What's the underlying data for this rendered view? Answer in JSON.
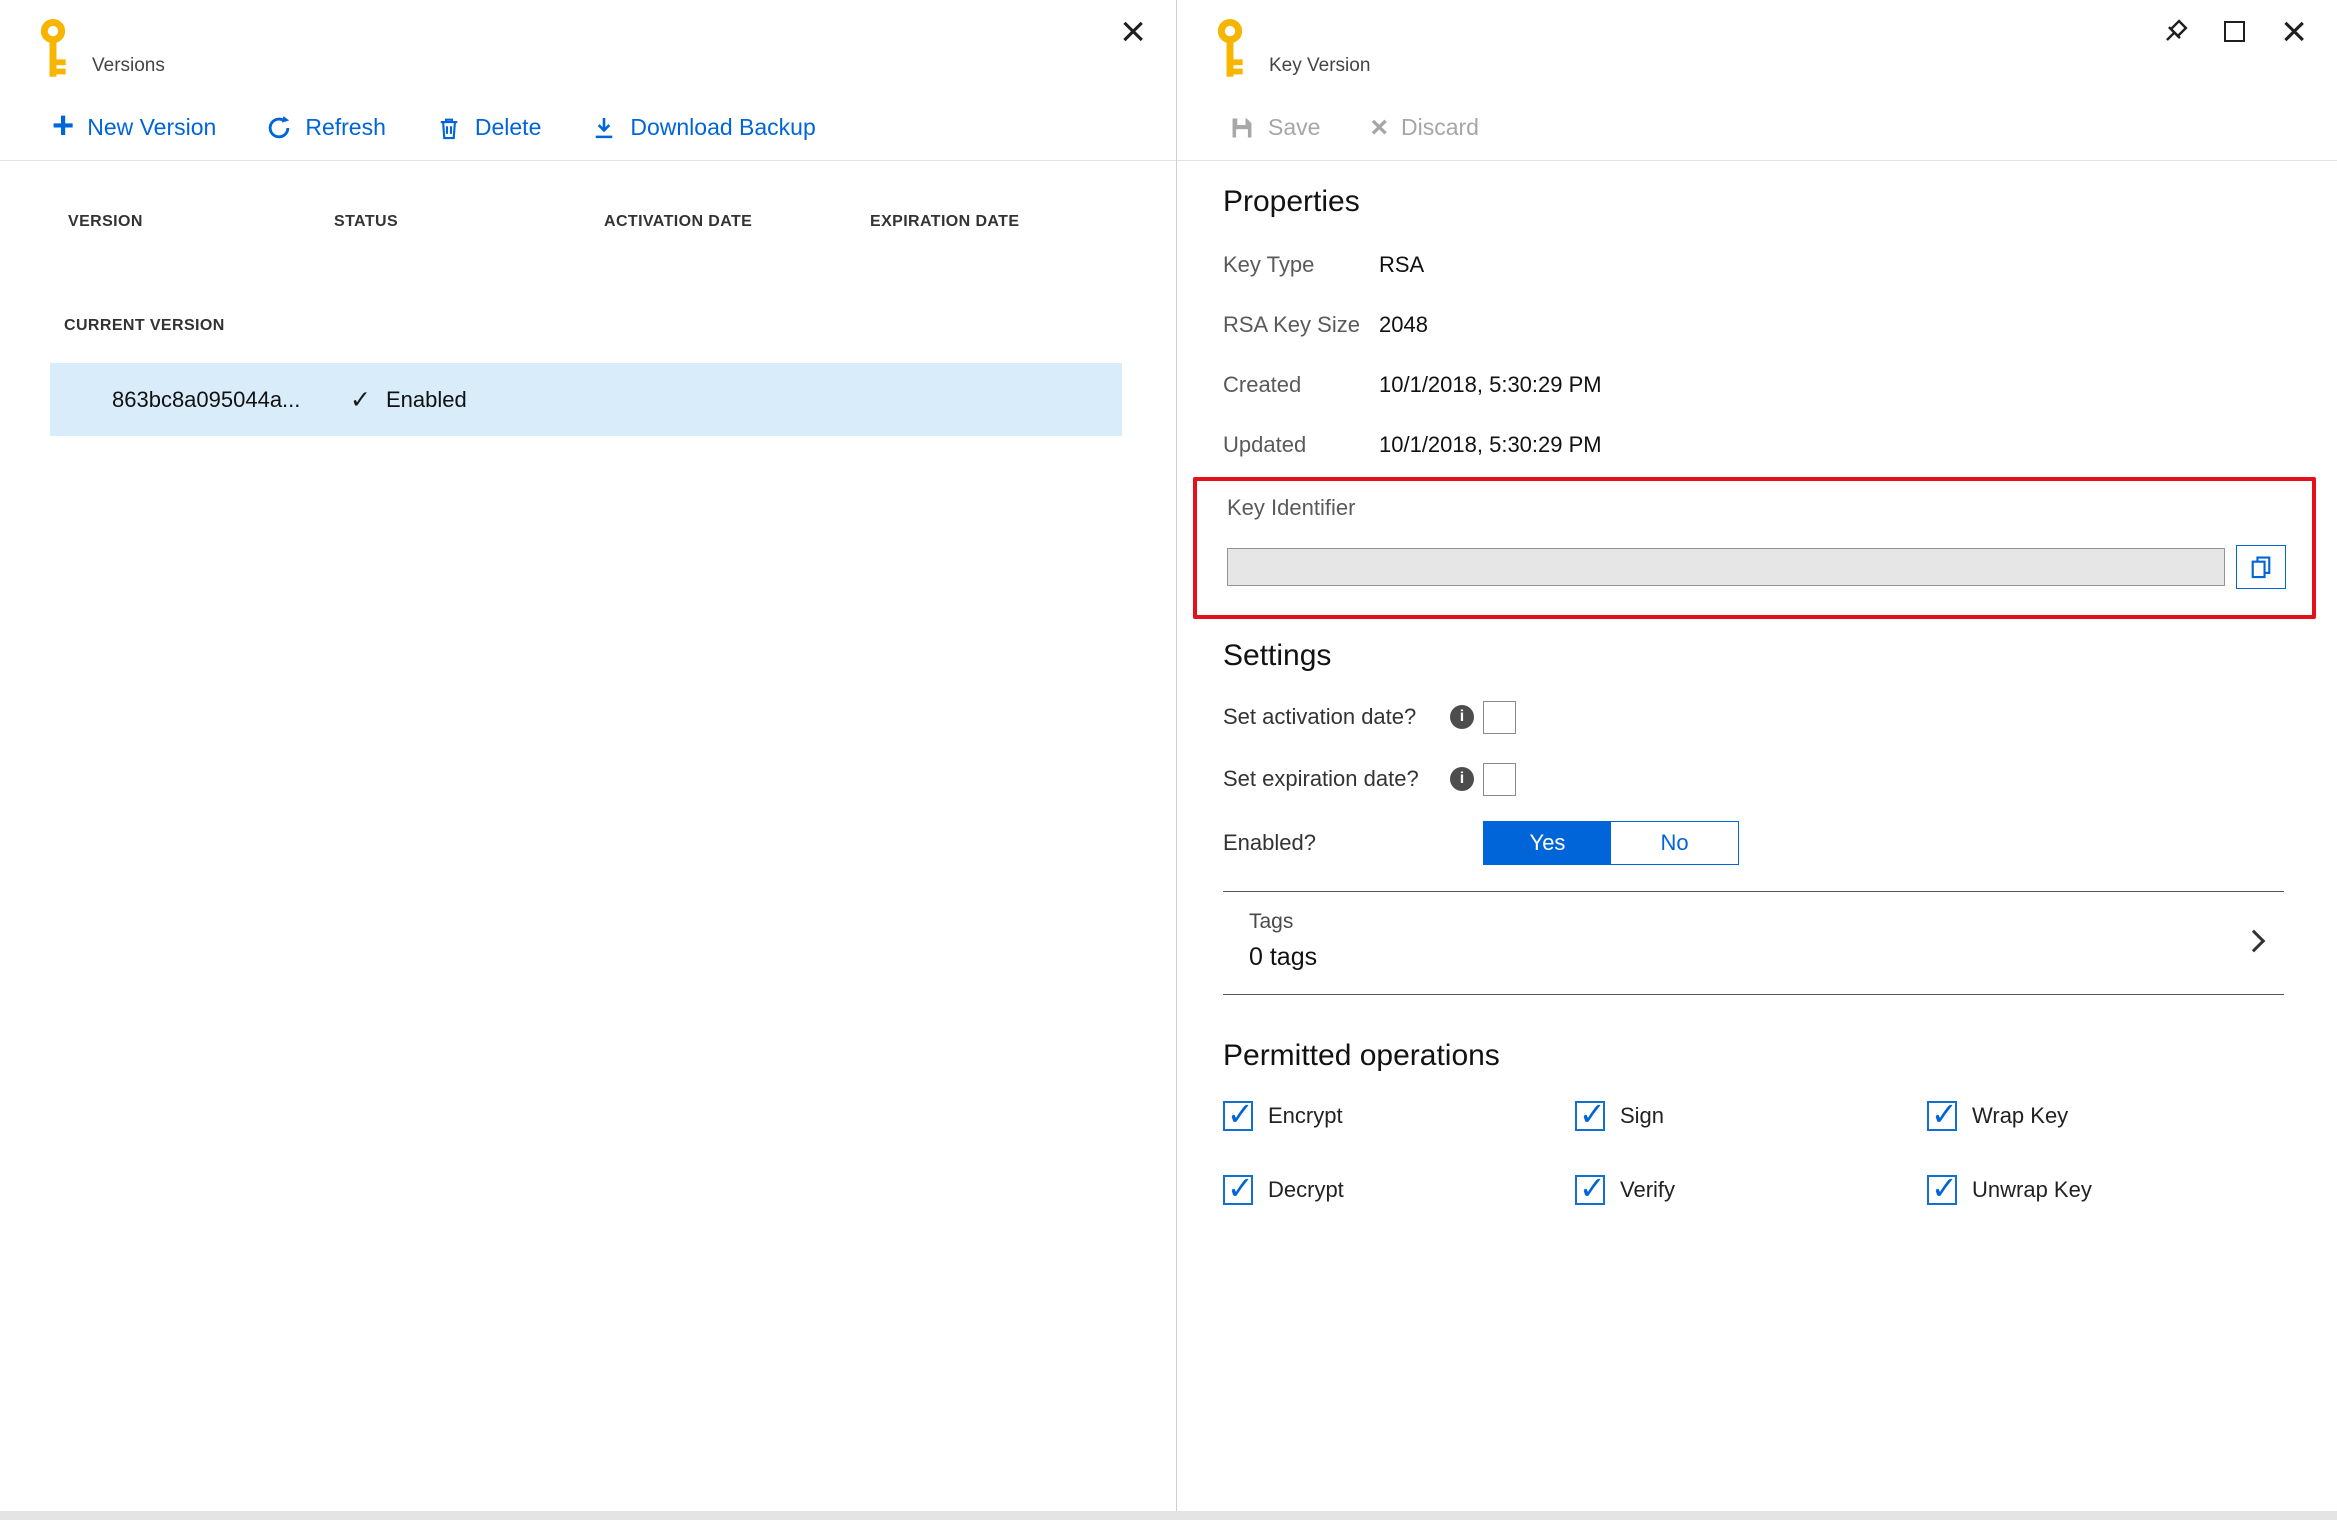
{
  "left_panel": {
    "title": "Versions",
    "toolbar": {
      "new_version": "New Version",
      "refresh": "Refresh",
      "delete": "Delete",
      "download_backup": "Download Backup"
    },
    "table": {
      "columns": [
        "VERSION",
        "STATUS",
        "ACTIVATION DATE",
        "EXPIRATION DATE"
      ],
      "group_label": "CURRENT VERSION",
      "rows": [
        {
          "version": "863bc8a095044a...",
          "status": "Enabled"
        }
      ]
    }
  },
  "right_panel": {
    "title": "Key Version",
    "toolbar": {
      "save": "Save",
      "discard": "Discard"
    },
    "properties": {
      "heading": "Properties",
      "fields": [
        {
          "label": "Key Type",
          "value": "RSA"
        },
        {
          "label": "RSA Key Size",
          "value": "2048"
        },
        {
          "label": "Created",
          "value": "10/1/2018, 5:30:29 PM"
        },
        {
          "label": "Updated",
          "value": "10/1/2018, 5:30:29 PM"
        }
      ],
      "key_identifier_label": "Key Identifier",
      "key_identifier_value": ""
    },
    "settings": {
      "heading": "Settings",
      "set_activation_label": "Set activation date?",
      "set_activation_checked": false,
      "set_expiration_label": "Set expiration date?",
      "set_expiration_checked": false,
      "enabled_label": "Enabled?",
      "enabled_yes": "Yes",
      "enabled_no": "No",
      "enabled_yes_selected": true,
      "enabled_no_selected": false,
      "tags_label": "Tags",
      "tags_value": "0 tags"
    },
    "permitted_operations": {
      "heading": "Permitted operations",
      "options": [
        {
          "label": "Encrypt",
          "checked": true
        },
        {
          "label": "Sign",
          "checked": true
        },
        {
          "label": "Wrap Key",
          "checked": true
        },
        {
          "label": "Decrypt",
          "checked": true
        },
        {
          "label": "Verify",
          "checked": true
        },
        {
          "label": "Unwrap Key",
          "checked": true
        }
      ]
    }
  },
  "colors": {
    "accent_blue": "#0065d9",
    "selected_row_blue": "#d9ecfa",
    "annotation_red": "#e3111c",
    "key_yellow": "#f7b500",
    "disabled_gray": "#a6a6a6"
  }
}
